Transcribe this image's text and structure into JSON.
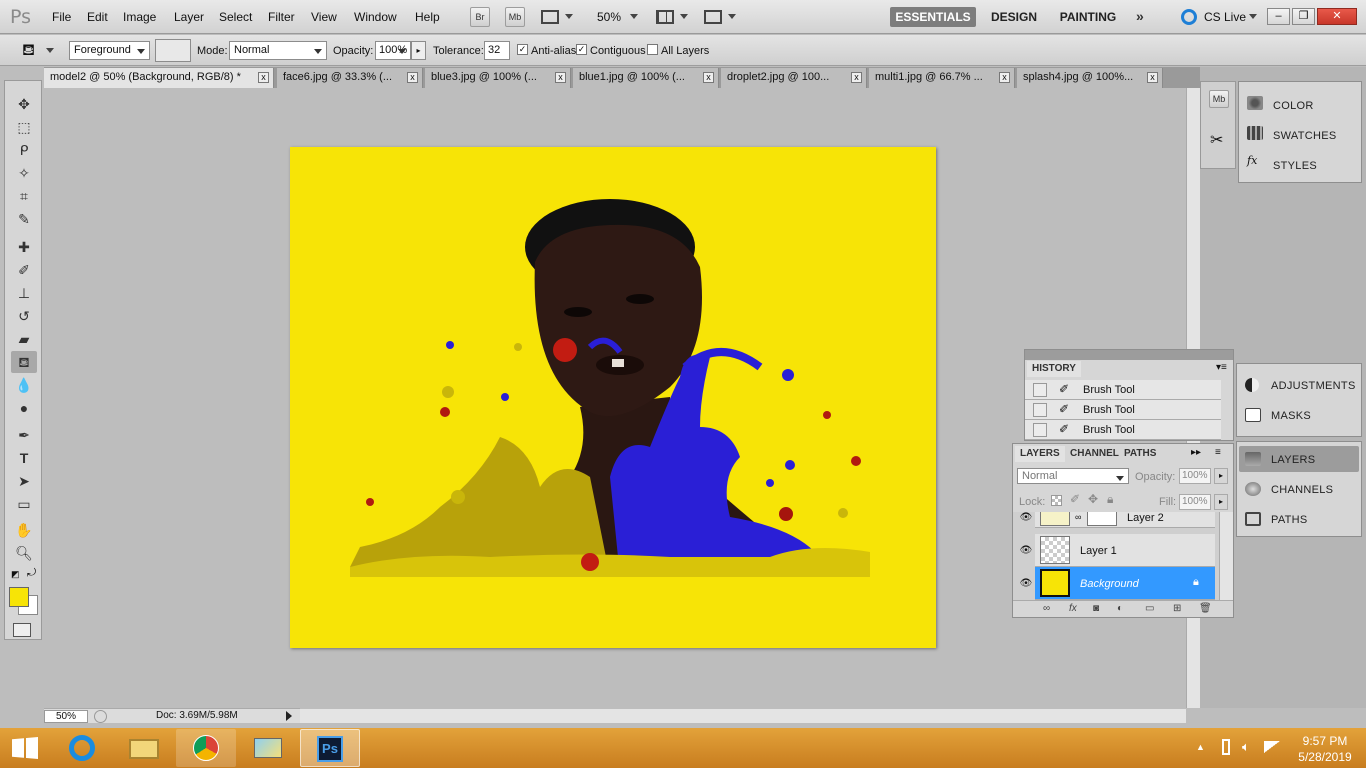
{
  "app": {
    "logo": "Ps"
  },
  "menu": [
    "File",
    "Edit",
    "Image",
    "Layer",
    "Select",
    "Filter",
    "View",
    "Window",
    "Help"
  ],
  "appbar": {
    "bridge": "Br",
    "minibridge": "Mb",
    "zoom": "50%"
  },
  "workspaces": [
    "ESSENTIALS",
    "DESIGN",
    "PAINTING"
  ],
  "cslive": "CS Live",
  "options": {
    "fill_source": "Foreground",
    "mode_label": "Mode:",
    "mode": "Normal",
    "opacity_label": "Opacity:",
    "opacity": "100%",
    "tolerance_label": "Tolerance:",
    "tolerance": "32",
    "antialias": "Anti-alias",
    "contiguous": "Contiguous",
    "all_layers": "All Layers"
  },
  "tabs": [
    {
      "label": "model2 @ 50% (Background, RGB/8) *"
    },
    {
      "label": "face6.jpg @ 33.3% (..."
    },
    {
      "label": "blue3.jpg @ 100% (..."
    },
    {
      "label": "blue1.jpg @ 100% (..."
    },
    {
      "label": "droplet2.jpg @ 100..."
    },
    {
      "label": "multi1.jpg @ 66.7% ..."
    },
    {
      "label": "splash4.jpg @ 100%..."
    }
  ],
  "status": {
    "zoom": "50%",
    "doc": "Doc: 3.69M/5.98M"
  },
  "panels_top": [
    "COLOR",
    "SWATCHES",
    "STYLES"
  ],
  "panels_mid": [
    "ADJUSTMENTS",
    "MASKS"
  ],
  "panels_bottom": [
    "LAYERS",
    "CHANNELS",
    "PATHS"
  ],
  "history": {
    "title": "HISTORY",
    "items": [
      "Brush Tool",
      "Brush Tool",
      "Brush Tool"
    ]
  },
  "layers_panel": {
    "tabs": [
      "LAYERS",
      "CHANNEL",
      "PATHS"
    ],
    "blend": "Normal",
    "opacity_label": "Opacity:",
    "opacity": "100%",
    "lock_label": "Lock:",
    "fill_label": "Fill:",
    "fill": "100%",
    "layers": [
      "Layer 2",
      "Layer 1",
      "Background"
    ]
  },
  "taskbar": {
    "time": "9:57 PM",
    "date": "5/28/2019",
    "ps_label": "Ps"
  },
  "colors": {
    "foreground": "#f7e406",
    "background_color": "#ffffff",
    "canvas": "#f7e406",
    "selection": "#3399ff"
  }
}
